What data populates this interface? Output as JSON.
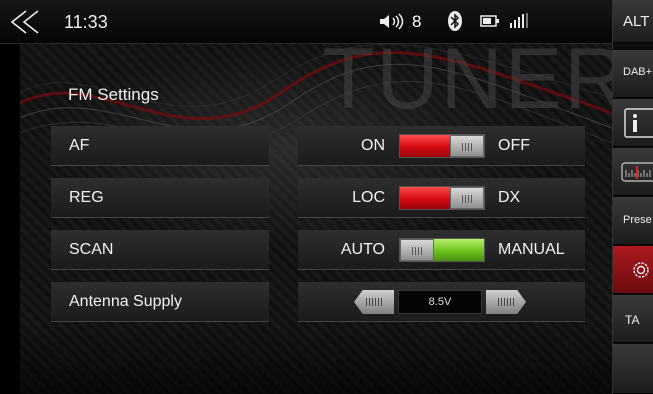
{
  "status_bar": {
    "time": "11:33",
    "volume": "8",
    "icons": [
      "back-chevron-icon",
      "speaker-icon",
      "bluetooth-icon",
      "battery-icon",
      "signal-icon"
    ]
  },
  "watermark": "TUNER",
  "page_title": "FM Settings",
  "rows": [
    {
      "label": "AF",
      "left_option": "ON",
      "right_option": "OFF",
      "selected": "ON"
    },
    {
      "label": "REG",
      "left_option": "LOC",
      "right_option": "DX",
      "selected": "LOC"
    },
    {
      "label": "SCAN",
      "left_option": "AUTO",
      "right_option": "MANUAL",
      "selected": "MANUAL"
    },
    {
      "label": "Antenna Supply",
      "value": "8.5V"
    }
  ],
  "side_panel": {
    "top_label": "ALT",
    "dab_label": "DAB+",
    "presets_label": "Prese",
    "ta_label": "TA",
    "icons": [
      "info-icon",
      "frequency-scale-icon",
      "settings-gear-icon"
    ]
  },
  "colors": {
    "toggle_on_red": "#d40b12",
    "toggle_on_green": "#6cc21e",
    "active_tab_red": "#ad1a1f"
  }
}
